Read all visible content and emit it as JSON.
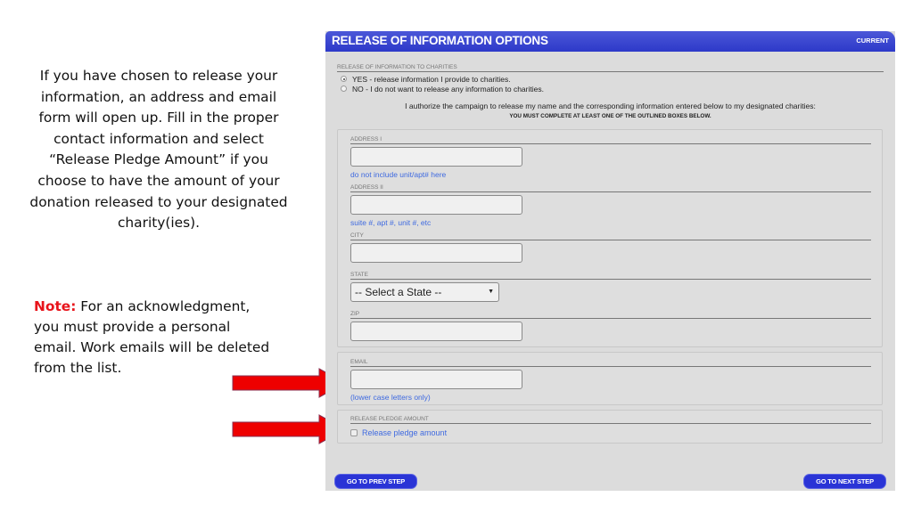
{
  "slide": {
    "instructions": "If you have chosen to release your information, an address and email form will open up.  Fill in the proper contact information and select “Release Pledge Amount” if you choose to have the amount of your donation released to your designated charity(ies).",
    "note_label": "Note:",
    "note_text": " For an acknowledgment, you must provide a personal email.  Work emails will be deleted from the list.",
    "arrow_color": "#ee0000"
  },
  "panel": {
    "title": "RELEASE OF INFORMATION OPTIONS",
    "status": "CURRENT",
    "header_color": "#2d39c9",
    "release_section": {
      "label": "RELEASE OF INFORMATION TO CHARITIES",
      "options": [
        {
          "label": "YES - release information I provide to charities.",
          "selected": true
        },
        {
          "label": "NO - I do not want to release any information to charities.",
          "selected": false
        }
      ],
      "authorization": "I authorize the campaign to release my name and the corresponding information entered below to my designated charities:",
      "requirement": "YOU MUST COMPLETE AT LEAST ONE OF THE OUTLINED BOXES BELOW."
    },
    "address": {
      "address1_label": "ADDRESS I",
      "address1_value": "",
      "address1_hint": "do not include unit/apt# here",
      "address2_label": "ADDRESS II",
      "address2_value": "",
      "address2_hint": "suite #, apt #, unit #, etc",
      "city_label": "CITY",
      "city_value": "",
      "state_label": "STATE",
      "state_selected": "-- Select a State --",
      "zip_label": "ZIP",
      "zip_value": ""
    },
    "email": {
      "label": "EMAIL",
      "value": "",
      "hint": "(lower case letters only)"
    },
    "pledge": {
      "label": "RELEASE PLEDGE AMOUNT",
      "checkbox_label": "Release pledge amount",
      "checked": false
    },
    "buttons": {
      "prev": "GO TO PREV STEP",
      "next": "GO TO NEXT STEP"
    }
  }
}
